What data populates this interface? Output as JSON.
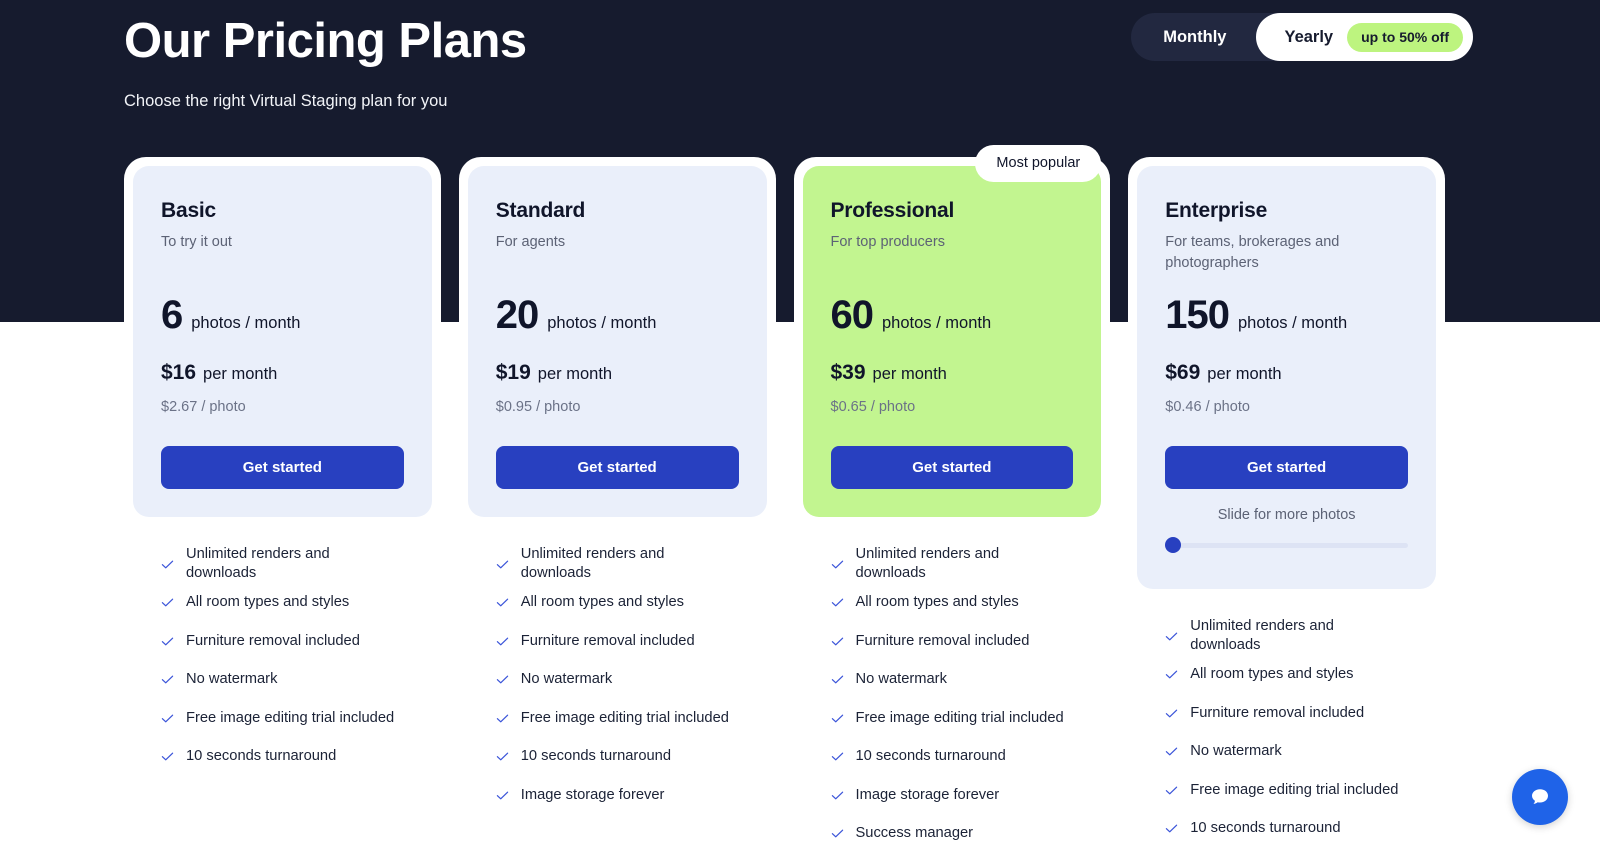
{
  "header": {
    "title": "Our Pricing Plans",
    "subtitle": "Choose the right Virtual Staging plan for you"
  },
  "billing_toggle": {
    "monthly_label": "Monthly",
    "yearly_label": "Yearly",
    "discount_badge": "up to 50% off",
    "selected": "Yearly"
  },
  "badges": {
    "most_popular": "Most popular"
  },
  "colors": {
    "hero_background": "#161b2e",
    "card_panel": "#eaeffa",
    "featured_panel": "#c2f590",
    "accent_blue": "#2840c0",
    "badge_green": "#bdf47f",
    "check_blue": "#3b55d9",
    "chat_blue": "#1f63e8"
  },
  "plans": [
    {
      "name": "Basic",
      "tagline": "To try it out",
      "quota_number": "6",
      "quota_unit": "photos / month",
      "price_amount": "$16",
      "price_period": "per month",
      "unit_price": "$2.67 / photo",
      "cta_label": "Get started",
      "featured": false,
      "features": [
        "Unlimited renders and downloads",
        "All room types and styles",
        "Furniture removal included",
        "No watermark",
        "Free image editing trial included",
        "10 seconds turnaround"
      ]
    },
    {
      "name": "Standard",
      "tagline": "For agents",
      "quota_number": "20",
      "quota_unit": "photos / month",
      "price_amount": "$19",
      "price_period": "per month",
      "unit_price": "$0.95 / photo",
      "cta_label": "Get started",
      "featured": false,
      "features": [
        "Unlimited renders and downloads",
        "All room types and styles",
        "Furniture removal included",
        "No watermark",
        "Free image editing trial included",
        "10 seconds turnaround",
        "Image storage forever"
      ]
    },
    {
      "name": "Professional",
      "tagline": "For top producers",
      "quota_number": "60",
      "quota_unit": "photos / month",
      "price_amount": "$39",
      "price_period": "per month",
      "unit_price": "$0.65 / photo",
      "cta_label": "Get started",
      "featured": true,
      "features": [
        "Unlimited renders and downloads",
        "All room types and styles",
        "Furniture removal included",
        "No watermark",
        "Free image editing trial included",
        "10 seconds turnaround",
        "Image storage forever",
        "Success manager"
      ]
    },
    {
      "name": "Enterprise",
      "tagline": "For teams, brokerages and photographers",
      "quota_number": "150",
      "quota_unit": "photos / month",
      "price_amount": "$69",
      "price_period": "per month",
      "unit_price": "$0.46 / photo",
      "cta_label": "Get started",
      "featured": false,
      "slider": {
        "label": "Slide for more photos",
        "value_percent": 0
      },
      "features": [
        "Unlimited renders and downloads",
        "All room types and styles",
        "Furniture removal included",
        "No watermark",
        "Free image editing trial included",
        "10 seconds turnaround"
      ]
    }
  ],
  "chat_widget": {
    "icon": "chat-bubble-icon"
  }
}
